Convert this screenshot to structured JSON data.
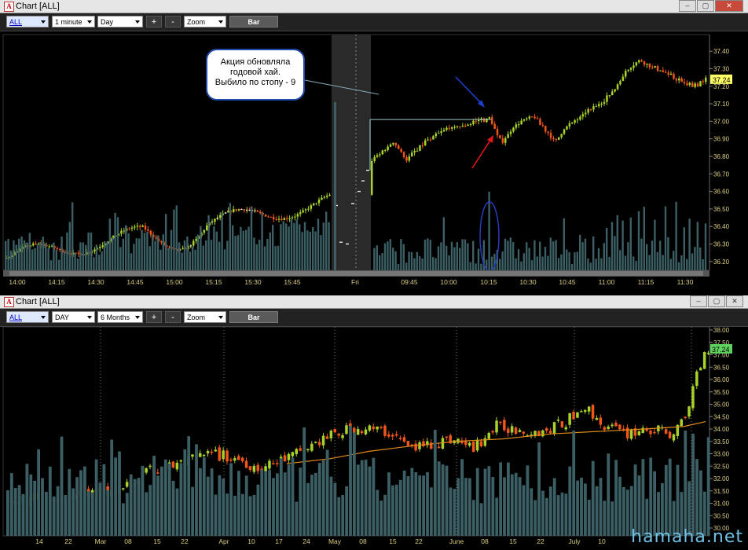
{
  "top": {
    "title": "Chart [ALL]",
    "window_buttons": [
      "–",
      "▢",
      "✕"
    ],
    "toolbar": {
      "symbol": "ALL",
      "interval": "1 minute",
      "range": "Day",
      "plus": "+",
      "minus": "-",
      "zoom": "Zoom",
      "bar": "Bar"
    },
    "price_ticks": [
      "37.40",
      "37.30",
      "37.20",
      "37.10",
      "37.00",
      "36.90",
      "36.80",
      "36.70",
      "36.60",
      "36.50",
      "36.40",
      "36.30",
      "36.20"
    ],
    "current_price": "37.24",
    "time_labels": [
      "14:00",
      "14:15",
      "14:30",
      "14:45",
      "15:00",
      "15:15",
      "15:30",
      "15:45",
      "Fri",
      "09:45",
      "10:00",
      "10:15",
      "10:30",
      "10:45",
      "11:00",
      "11:15",
      "11:30"
    ],
    "callout": [
      "Акция обновляла",
      "годовой хай.",
      "Выбило по стопу - 9"
    ]
  },
  "bottom": {
    "title": "Chart [ALL]",
    "window_buttons": [
      "–",
      "▢",
      "✕"
    ],
    "toolbar": {
      "symbol": "ALL",
      "interval": "DAY",
      "range": "6 Months",
      "plus": "+",
      "minus": "-",
      "zoom": "Zoom",
      "bar": "Bar"
    },
    "price_ticks": [
      "38.00",
      "37.50",
      "37.00",
      "36.50",
      "36.00",
      "35.50",
      "35.00",
      "34.50",
      "34.00",
      "33.50",
      "33.00",
      "32.50",
      "32.00",
      "31.50",
      "31.00",
      "30.50",
      "30.00"
    ],
    "current_price": "37.24",
    "date_labels": [
      "14",
      "22",
      "Mar",
      "08",
      "15",
      "22",
      "Apr",
      "10",
      "17",
      "24",
      "May",
      "08",
      "15",
      "22",
      "June",
      "08",
      "15",
      "22",
      "July",
      "10"
    ]
  },
  "watermark": "hamaha.net",
  "colors": {
    "up": "#a8d22a",
    "down": "#f0561a",
    "volume": "#3b5f64",
    "ma": "#e08a1c",
    "price_tag": "#ffff66",
    "price_tag_green": "#5fd35f"
  }
}
